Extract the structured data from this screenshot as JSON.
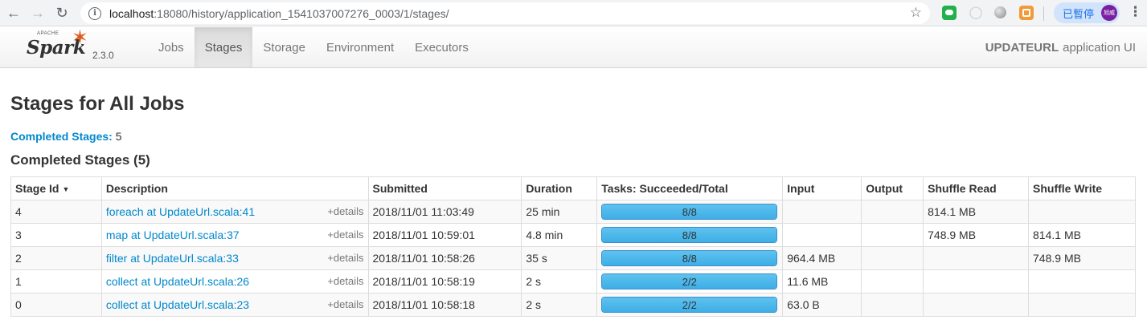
{
  "browser": {
    "url_host": "localhost",
    "url_rest": ":18080/history/application_1541037007276_0003/1/stages/",
    "paused_label": "已暫停",
    "avatar_text": "旭威"
  },
  "navbar": {
    "brand_apache": "APACHE",
    "brand_name": "Spark",
    "version": "2.3.0",
    "tabs": [
      {
        "label": "Jobs",
        "active": false
      },
      {
        "label": "Stages",
        "active": true
      },
      {
        "label": "Storage",
        "active": false
      },
      {
        "label": "Environment",
        "active": false
      },
      {
        "label": "Executors",
        "active": false
      }
    ],
    "app_name": "UPDATEURL",
    "app_suffix": "application UI"
  },
  "page": {
    "title": "Stages for All Jobs",
    "summary_label": "Completed Stages:",
    "summary_count": "5",
    "section_title": "Completed Stages (5)"
  },
  "table": {
    "columns": [
      "Stage Id",
      "Description",
      "Submitted",
      "Duration",
      "Tasks: Succeeded/Total",
      "Input",
      "Output",
      "Shuffle Read",
      "Shuffle Write"
    ],
    "details_label": "+details",
    "rows": [
      {
        "stage_id": "4",
        "description": "foreach at UpdateUrl.scala:41",
        "submitted": "2018/11/01 11:03:49",
        "duration": "25 min",
        "tasks": "8/8",
        "progress": 1.0,
        "input": "",
        "output": "",
        "shuffle_read": "814.1 MB",
        "shuffle_write": ""
      },
      {
        "stage_id": "3",
        "description": "map at UpdateUrl.scala:37",
        "submitted": "2018/11/01 10:59:01",
        "duration": "4.8 min",
        "tasks": "8/8",
        "progress": 1.0,
        "input": "",
        "output": "",
        "shuffle_read": "748.9 MB",
        "shuffle_write": "814.1 MB"
      },
      {
        "stage_id": "2",
        "description": "filter at UpdateUrl.scala:33",
        "submitted": "2018/11/01 10:58:26",
        "duration": "35 s",
        "tasks": "8/8",
        "progress": 1.0,
        "input": "964.4 MB",
        "output": "",
        "shuffle_read": "",
        "shuffle_write": "748.9 MB"
      },
      {
        "stage_id": "1",
        "description": "collect at UpdateUrl.scala:26",
        "submitted": "2018/11/01 10:58:19",
        "duration": "2 s",
        "tasks": "2/2",
        "progress": 1.0,
        "input": "11.6 MB",
        "output": "",
        "shuffle_read": "",
        "shuffle_write": ""
      },
      {
        "stage_id": "0",
        "description": "collect at UpdateUrl.scala:23",
        "submitted": "2018/11/01 10:58:18",
        "duration": "2 s",
        "tasks": "2/2",
        "progress": 1.0,
        "input": "63.0 B",
        "output": "",
        "shuffle_read": "",
        "shuffle_write": ""
      }
    ]
  },
  "colors": {
    "link": "#0088cc",
    "progress_fill": "#3eaee6",
    "spark_flame": "#e25a1c"
  }
}
